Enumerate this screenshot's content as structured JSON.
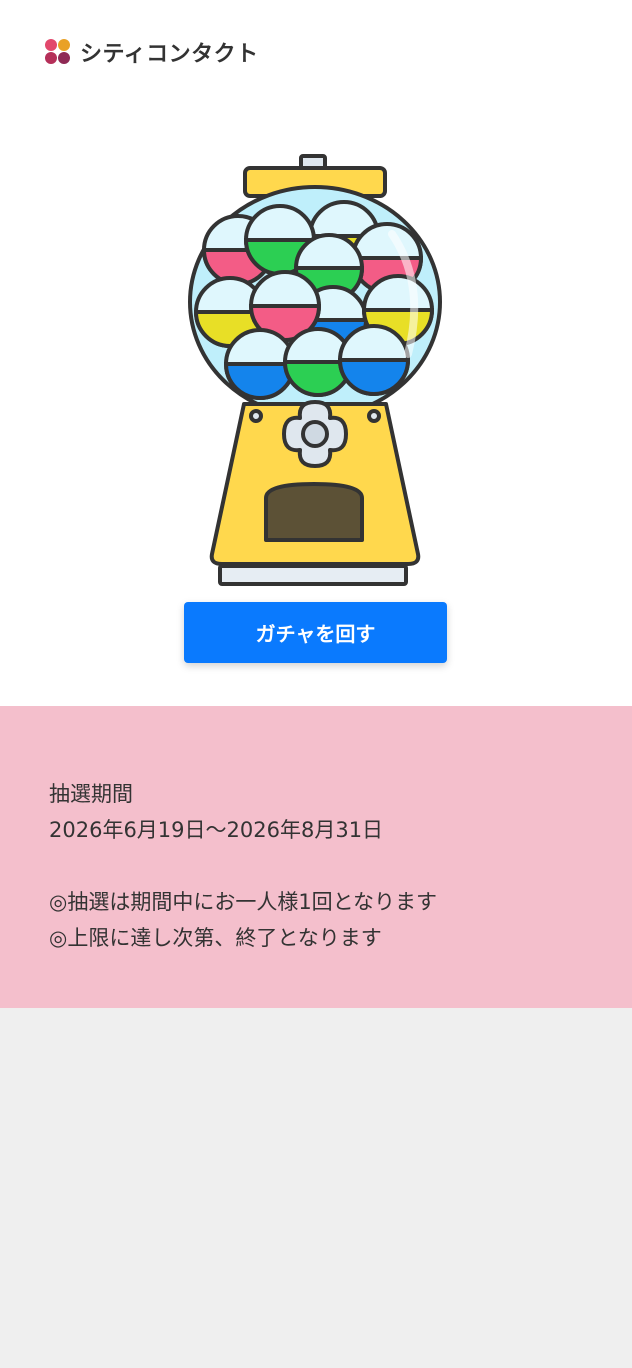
{
  "brand": {
    "name": "シティコンタクト",
    "logo_colors": [
      "#e9a126",
      "#e2486c",
      "#b52f59",
      "#8f2a55"
    ]
  },
  "machine": {
    "icon": "gacha-machine-icon",
    "colors": {
      "body": "#ffd84d",
      "globe": "#bfeffb",
      "outline": "#333333",
      "slot": "#5c5136",
      "red": "#f35c86",
      "green": "#2ccf53",
      "yellow": "#e8df26",
      "blue": "#1484ec"
    }
  },
  "button": {
    "label": "ガチャを回す",
    "color": "#0a7afe"
  },
  "info": {
    "heading": "抽選期間",
    "period": "2026年6月19日〜2026年8月31日",
    "note1": "◎抽選は期間中にお一人様1回となります",
    "note2": "◎上限に達し次第、終了となります",
    "background": "#f4bfcc"
  }
}
